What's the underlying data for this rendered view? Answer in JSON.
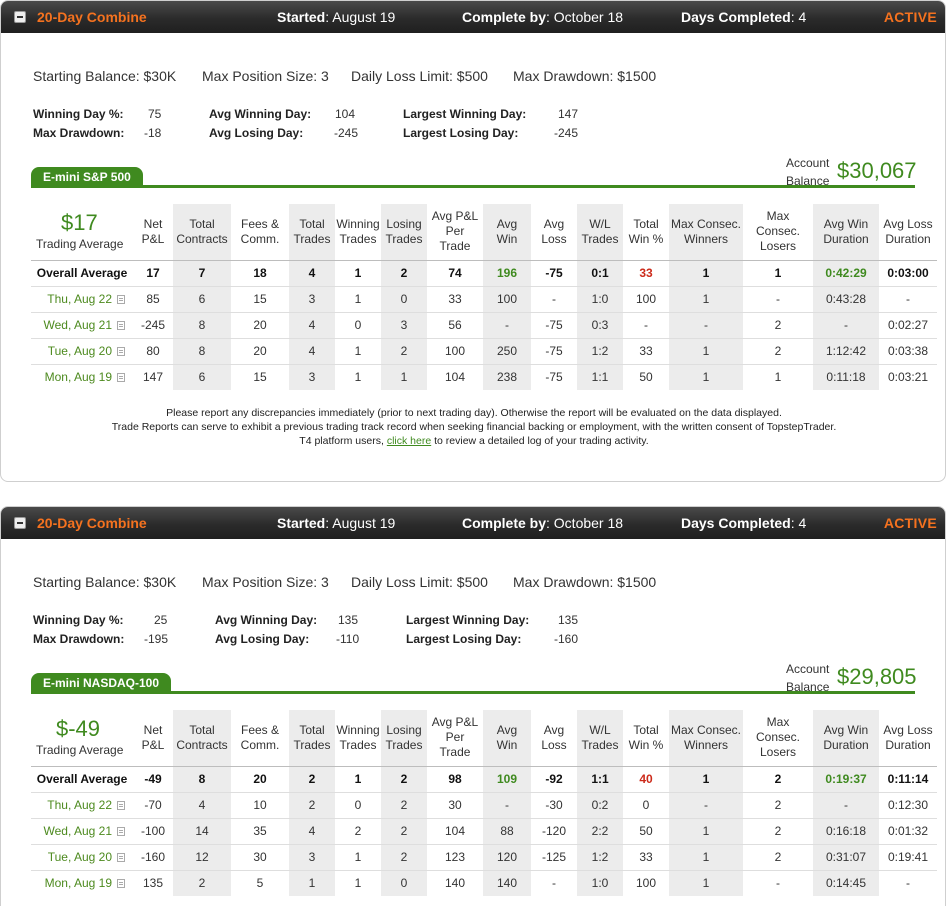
{
  "panels": [
    {
      "header": {
        "name": "20-Day Combine",
        "started_label": "Started",
        "started_value": "August 19",
        "complete_label": "Complete by",
        "complete_value": "October 18",
        "days_label": "Days Completed",
        "days_value": "4",
        "status": "ACTIVE"
      },
      "rules": {
        "starting_balance": "Starting Balance: $30K",
        "max_position": "Max Position Size: 3",
        "daily_loss": "Daily Loss Limit: $500",
        "max_drawdown": "Max Drawdown: $1500"
      },
      "stats": {
        "winning_day_pct_label": "Winning Day %:",
        "winning_day_pct": "75",
        "max_drawdown_label": "Max Drawdown:",
        "max_drawdown": "-18",
        "avg_winning_day_label": "Avg Winning Day:",
        "avg_winning_day": "104",
        "avg_losing_day_label": "Avg Losing Day:",
        "avg_losing_day": "-245",
        "largest_winning_day_label": "Largest Winning Day:",
        "largest_winning_day": "147",
        "largest_losing_day_label": "Largest Losing Day:",
        "largest_losing_day": "-245"
      },
      "instrument": "E-mini S&P 500",
      "account_label_1": "Account",
      "account_label_2": "Balance",
      "account_balance": "$30,067",
      "trading_average_value": "$17",
      "trading_average_label": "Trading Average",
      "columns": [
        [
          "Net",
          "P&L"
        ],
        [
          "Total",
          "Contracts"
        ],
        [
          "Fees &",
          "Comm."
        ],
        [
          "Total",
          "Trades"
        ],
        [
          "Winning",
          "Trades"
        ],
        [
          "Losing",
          "Trades"
        ],
        [
          "Avg P&L",
          "Per",
          "Trade"
        ],
        [
          "Avg",
          "Win"
        ],
        [
          "Avg",
          "Loss"
        ],
        [
          "W/L",
          "Trades"
        ],
        [
          "Total",
          "Win %"
        ],
        [
          "Max Consec.",
          "Winners"
        ],
        [
          "Max Consec.",
          "Losers"
        ],
        [
          "Avg Win",
          "Duration"
        ],
        [
          "Avg Loss",
          "Duration"
        ]
      ],
      "overall_label": "Overall Average",
      "overall": [
        "17",
        "7",
        "18",
        "4",
        "1",
        "2",
        "74",
        "196",
        "-75",
        "0:1",
        "33",
        "1",
        "1",
        "0:42:29",
        "0:03:00"
      ],
      "rows": [
        {
          "date": "Thu, Aug 22",
          "cells": [
            "85",
            "6",
            "15",
            "3",
            "1",
            "0",
            "33",
            "100",
            "-",
            "1:0",
            "100",
            "1",
            "-",
            "0:43:28",
            "-"
          ]
        },
        {
          "date": "Wed, Aug 21",
          "cells": [
            "-245",
            "8",
            "20",
            "4",
            "0",
            "3",
            "56",
            "-",
            "-75",
            "0:3",
            "-",
            "-",
            "2",
            "-",
            "0:02:27"
          ]
        },
        {
          "date": "Tue, Aug 20",
          "cells": [
            "80",
            "8",
            "20",
            "4",
            "1",
            "2",
            "100",
            "250",
            "-75",
            "1:2",
            "33",
            "1",
            "2",
            "1:12:42",
            "0:03:38"
          ]
        },
        {
          "date": "Mon, Aug 19",
          "cells": [
            "147",
            "6",
            "15",
            "3",
            "1",
            "1",
            "104",
            "238",
            "-75",
            "1:1",
            "50",
            "1",
            "1",
            "0:11:18",
            "0:03:21"
          ]
        }
      ],
      "notes": {
        "line1": "Please report any discrepancies immediately (prior to next trading day). Otherwise the report will be evaluated on the data displayed.",
        "line2": "Trade Reports can serve to exhibit a previous trading track record when seeking financial backing or employment, with the written consent of TopstepTrader.",
        "line3_pre": "T4 platform users,",
        "link": "click here",
        "line3_post": "to review a detailed log of your trading activity."
      }
    },
    {
      "header": {
        "name": "20-Day Combine",
        "started_label": "Started",
        "started_value": "August 19",
        "complete_label": "Complete by",
        "complete_value": "October 18",
        "days_label": "Days Completed",
        "days_value": "4",
        "status": "ACTIVE"
      },
      "rules": {
        "starting_balance": "Starting Balance: $30K",
        "max_position": "Max Position Size: 3",
        "daily_loss": "Daily Loss Limit: $500",
        "max_drawdown": "Max Drawdown: $1500"
      },
      "stats": {
        "winning_day_pct_label": "Winning Day %:",
        "winning_day_pct": "25",
        "max_drawdown_label": "Max Drawdown:",
        "max_drawdown": "-195",
        "avg_winning_day_label": "Avg Winning Day:",
        "avg_winning_day": "135",
        "avg_losing_day_label": "Avg Losing Day:",
        "avg_losing_day": "-110",
        "largest_winning_day_label": "Largest Winning Day:",
        "largest_winning_day": "135",
        "largest_losing_day_label": "Largest Losing Day:",
        "largest_losing_day": "-160"
      },
      "instrument": "E-mini NASDAQ-100",
      "account_label_1": "Account",
      "account_label_2": "Balance",
      "account_balance": "$29,805",
      "trading_average_value": "$-49",
      "trading_average_label": "Trading Average",
      "columns": [
        [
          "Net",
          "P&L"
        ],
        [
          "Total",
          "Contracts"
        ],
        [
          "Fees &",
          "Comm."
        ],
        [
          "Total",
          "Trades"
        ],
        [
          "Winning",
          "Trades"
        ],
        [
          "Losing",
          "Trades"
        ],
        [
          "Avg P&L",
          "Per",
          "Trade"
        ],
        [
          "Avg",
          "Win"
        ],
        [
          "Avg",
          "Loss"
        ],
        [
          "W/L",
          "Trades"
        ],
        [
          "Total",
          "Win %"
        ],
        [
          "Max Consec.",
          "Winners"
        ],
        [
          "Max Consec.",
          "Losers"
        ],
        [
          "Avg Win",
          "Duration"
        ],
        [
          "Avg Loss",
          "Duration"
        ]
      ],
      "overall_label": "Overall Average",
      "overall": [
        "-49",
        "8",
        "20",
        "2",
        "1",
        "2",
        "98",
        "109",
        "-92",
        "1:1",
        "40",
        "1",
        "2",
        "0:19:37",
        "0:11:14"
      ],
      "rows": [
        {
          "date": "Thu, Aug 22",
          "cells": [
            "-70",
            "4",
            "10",
            "2",
            "0",
            "2",
            "30",
            "-",
            "-30",
            "0:2",
            "0",
            "-",
            "2",
            "-",
            "0:12:30"
          ]
        },
        {
          "date": "Wed, Aug 21",
          "cells": [
            "-100",
            "14",
            "35",
            "4",
            "2",
            "2",
            "104",
            "88",
            "-120",
            "2:2",
            "50",
            "1",
            "2",
            "0:16:18",
            "0:01:32"
          ]
        },
        {
          "date": "Tue, Aug 20",
          "cells": [
            "-160",
            "12",
            "30",
            "3",
            "1",
            "2",
            "123",
            "120",
            "-125",
            "1:2",
            "33",
            "1",
            "2",
            "0:31:07",
            "0:19:41"
          ]
        },
        {
          "date": "Mon, Aug 19",
          "cells": [
            "135",
            "2",
            "5",
            "1",
            "1",
            "0",
            "140",
            "140",
            "-",
            "1:0",
            "100",
            "1",
            "-",
            "0:14:45",
            "-"
          ]
        }
      ]
    }
  ],
  "colors": {
    "accent_orange": "#f5721f",
    "green": "#3f8a1f",
    "red": "#cc2a1a"
  }
}
